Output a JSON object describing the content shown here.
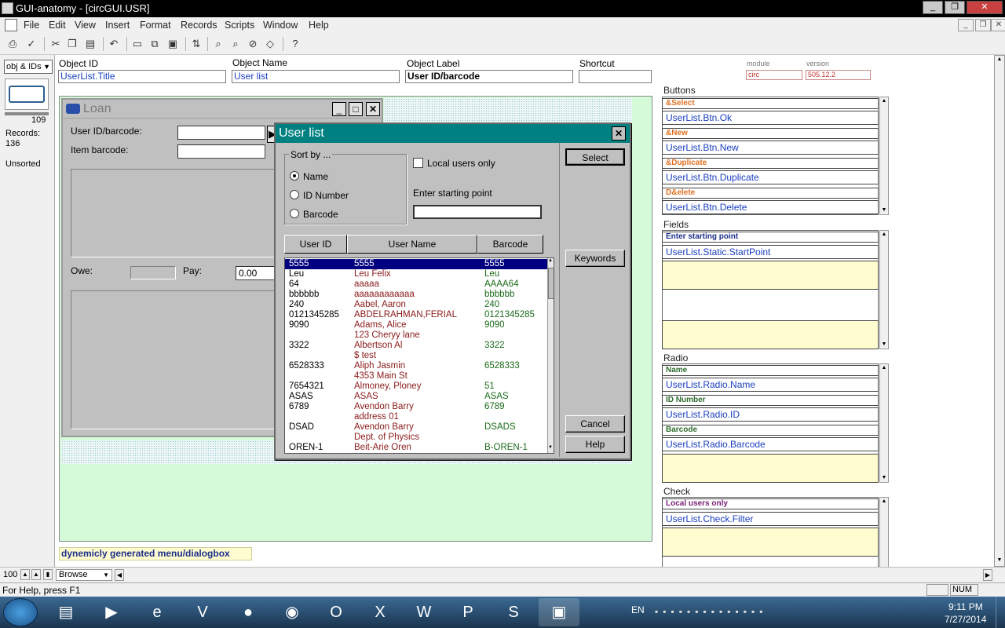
{
  "app": {
    "title": "GUI-anatomy - [circGUI.USR]"
  },
  "menu": [
    "File",
    "Edit",
    "View",
    "Insert",
    "Format",
    "Records",
    "Scripts",
    "Window",
    "Help"
  ],
  "sidebar": {
    "layout_select": "obj & IDs",
    "count": "109",
    "records_label": "Records:",
    "records_count": "136",
    "sort_status": "Unsorted"
  },
  "header": {
    "object_id_label": "Object ID",
    "object_id_value": "UserList.Title",
    "object_name_label": "Object Name",
    "object_name_value": "User list",
    "object_label_label": "Object Label",
    "object_label_value": "User ID/barcode",
    "shortcut_label": "Shortcut",
    "shortcut_value": "",
    "module_label": "module",
    "module_value": "circ",
    "version_label": "version",
    "version_value": "505.12.2"
  },
  "loan": {
    "title": "Loan",
    "user_id_label": "User ID/barcode:",
    "item_barcode_label": "Item barcode:",
    "owe_label": "Owe:",
    "pay_label": "Pay:",
    "pay_value": "0.00"
  },
  "userlist": {
    "title": "User list",
    "sort_by": "Sort by ...",
    "radio_name": "Name",
    "radio_id": "ID Number",
    "radio_barcode": "Barcode",
    "local_users": "Local users only",
    "starting_point_label": "Enter starting point",
    "btn_select": "Select",
    "btn_keywords": "Keywords",
    "btn_cancel": "Cancel",
    "btn_help": "Help",
    "columns": [
      "User ID",
      "User Name",
      "Barcode"
    ],
    "rows": [
      {
        "id": "5555",
        "name": "5555",
        "barcode": "5555"
      },
      {
        "id": "Leu",
        "name": "Leu Felix",
        "barcode": "Leu"
      },
      {
        "id": "64",
        "name": "aaaaa",
        "barcode": "AAAA64"
      },
      {
        "id": "bbbbbb",
        "name": "aaaaaaaaaaaa",
        "barcode": "bbbbbb"
      },
      {
        "id": "240",
        "name": "Aabel, Aaron",
        "barcode": "240"
      },
      {
        "id": "0121345285",
        "name": "ABDELRAHMAN,FERIAL",
        "barcode": "0121345285"
      },
      {
        "id": "9090",
        "name": "Adams, Alice",
        "barcode": "9090"
      },
      {
        "id": "",
        "name": "123 Cheryy lane",
        "barcode": ""
      },
      {
        "id": "3322",
        "name": "Albertson Al",
        "barcode": "3322"
      },
      {
        "id": "",
        "name": "$ test",
        "barcode": ""
      },
      {
        "id": "6528333",
        "name": "Aliph Jasmin",
        "barcode": "6528333"
      },
      {
        "id": "",
        "name": "4353 Main St",
        "barcode": ""
      },
      {
        "id": "7654321",
        "name": "Almoney, Ploney",
        "barcode": "51"
      },
      {
        "id": "ASAS",
        "name": "ASAS",
        "barcode": "ASAS"
      },
      {
        "id": "6789",
        "name": "Avendon Barry",
        "barcode": "6789"
      },
      {
        "id": "",
        "name": "address 01",
        "barcode": ""
      },
      {
        "id": "DSAD",
        "name": "Avendon Barry",
        "barcode": "DSADS"
      },
      {
        "id": "",
        "name": "Dept. of Physics",
        "barcode": ""
      },
      {
        "id": "OREN-1",
        "name": "Beit-Arie Oren",
        "barcode": "B-OREN-1"
      }
    ]
  },
  "footer_note": "dynemicly generated menu/dialogbox",
  "panel": {
    "buttons_title": "Buttons",
    "buttons": [
      {
        "label": "&Select",
        "id": "UserList.Btn.Ok"
      },
      {
        "label": "&New",
        "id": "UserList.Btn.New"
      },
      {
        "label": "&Duplicate",
        "id": "UserList.Btn.Duplicate"
      },
      {
        "label": "D&elete",
        "id": "UserList.Btn.Delete"
      }
    ],
    "fields_title": "Fields",
    "fields": [
      {
        "label": "Enter starting point",
        "id": "UserList.Static.StartPoint"
      }
    ],
    "radio_title": "Radio",
    "radios": [
      {
        "label": "Name",
        "id": "UserList.Radio.Name"
      },
      {
        "label": "ID Number",
        "id": "UserList.Radio.ID"
      },
      {
        "label": "Barcode",
        "id": "UserList.Radio.Barcode"
      }
    ],
    "check_title": "Check",
    "checks": [
      {
        "label": "Local users only",
        "id": "UserList.Check.Filter"
      }
    ]
  },
  "bottom": {
    "zoom": "100",
    "mode": "Browse"
  },
  "status": {
    "help": "For Help, press F1",
    "num": "NUM"
  },
  "taskbar": {
    "lang": "EN",
    "time": "9:11 PM",
    "date": "7/27/2014"
  },
  "colors": {
    "accent_teal": "#008080",
    "canvas_green": "#d4fad8",
    "selection_navy": "#000080"
  }
}
